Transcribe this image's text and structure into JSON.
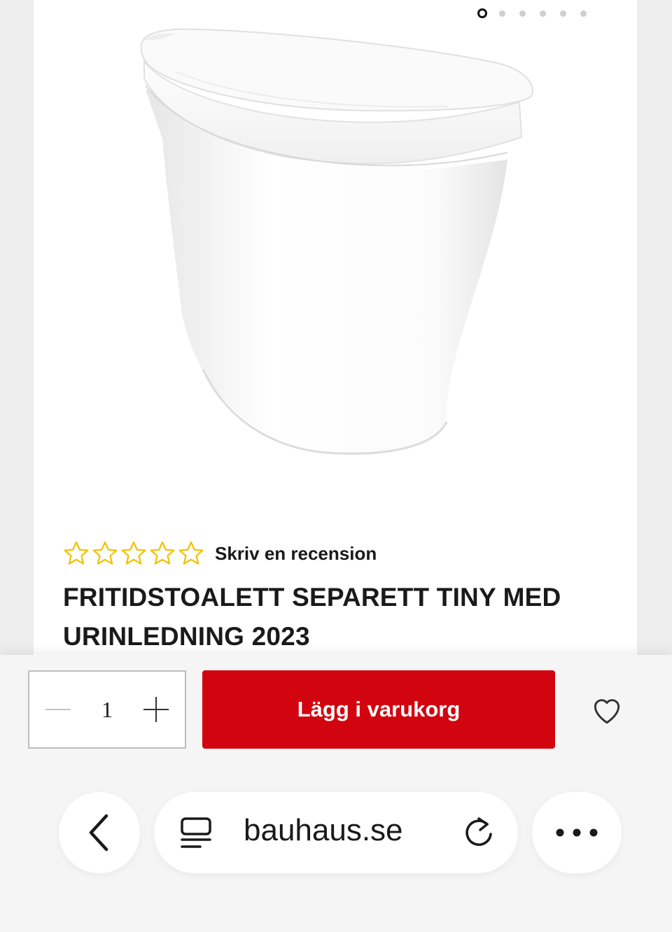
{
  "carousel": {
    "total_images": 6,
    "active_index": 0
  },
  "product": {
    "rating_stars": 0,
    "rating_max": 5,
    "review_link": "Skriv en recension",
    "title": "FRITIDSTOALETT SEPARETT TINY MED URINLEDNING 2023"
  },
  "purchase": {
    "quantity": "1",
    "add_to_cart_label": "Lägg i varukorg"
  },
  "browser": {
    "url": "bauhaus.se"
  },
  "colors": {
    "accent_red": "#d2040f",
    "star_outline": "#f2c200"
  },
  "icons": [
    "minus-icon",
    "plus-icon",
    "heart-icon",
    "chevron-left-icon",
    "reader-mode-icon",
    "reload-icon",
    "more-icon",
    "star-outline-icon"
  ]
}
